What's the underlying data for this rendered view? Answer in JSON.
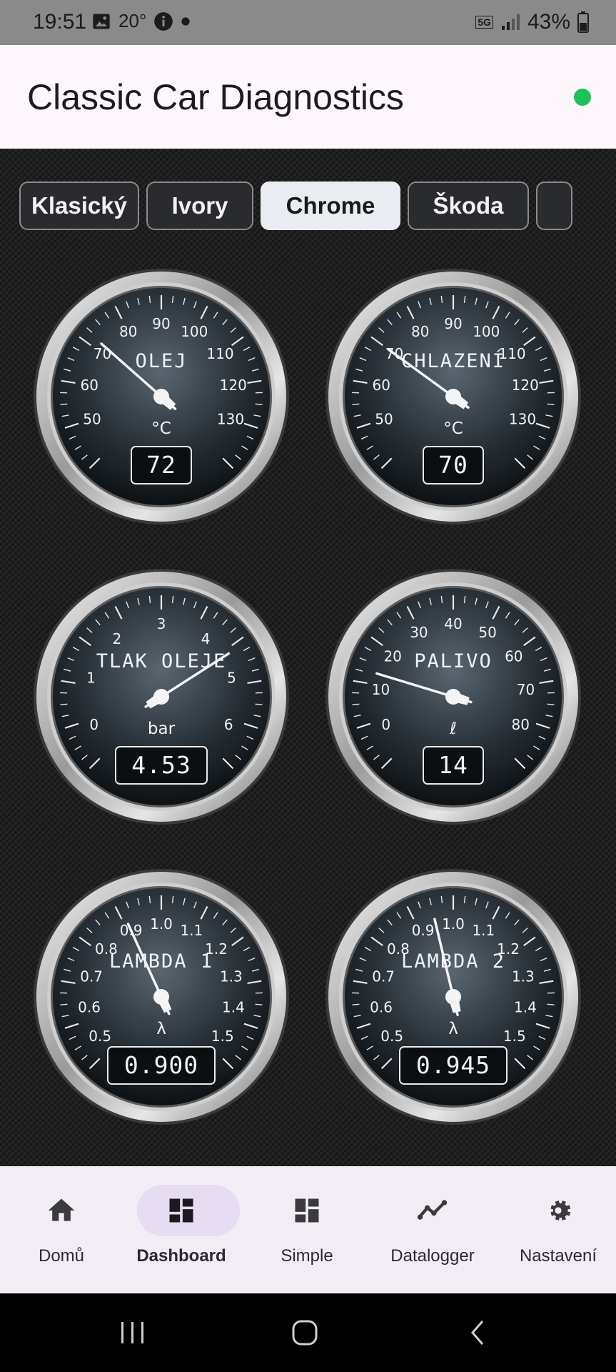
{
  "status_bar": {
    "time": "19:51",
    "temperature": "20°",
    "network": "5G",
    "battery": "43%",
    "icons": [
      "image-icon",
      "info-icon",
      "dot-icon",
      "signal-icon",
      "battery-icon"
    ]
  },
  "app": {
    "title": "Classic Car Diagnostics",
    "connection_color": "#1ec05a"
  },
  "theme_tabs": [
    {
      "label": "Klasický",
      "active": false
    },
    {
      "label": "Ivory",
      "active": false
    },
    {
      "label": "Chrome",
      "active": true
    },
    {
      "label": "Škoda",
      "active": false
    },
    {
      "label": "",
      "active": false
    }
  ],
  "gauges": [
    {
      "title": "OLEJ",
      "unit": "°C",
      "display": "72",
      "value": 72,
      "min": 40,
      "max": 140,
      "tick_labels": [
        "50",
        "60",
        "70",
        "80",
        "90",
        "100",
        "110",
        "120",
        "130"
      ],
      "tick_values": [
        50,
        60,
        70,
        80,
        90,
        100,
        110,
        120,
        130
      ]
    },
    {
      "title": "CHLAZENÍ",
      "unit": "°C",
      "display": "70",
      "value": 70,
      "min": 40,
      "max": 140,
      "tick_labels": [
        "50",
        "60",
        "70",
        "80",
        "90",
        "100",
        "110",
        "120",
        "130"
      ],
      "tick_values": [
        50,
        60,
        70,
        80,
        90,
        100,
        110,
        120,
        130
      ]
    },
    {
      "title": "TLAK OLEJE",
      "unit": "bar",
      "display": "4.53",
      "value": 4.53,
      "min": -0.6,
      "max": 6.6,
      "tick_labels": [
        "0",
        "1",
        "2",
        "3",
        "4",
        "5",
        "6"
      ],
      "tick_values": [
        0,
        1,
        2,
        3,
        4,
        5,
        6
      ]
    },
    {
      "title": "PALIVO",
      "unit": "ℓ",
      "display": "14",
      "value": 14,
      "min": -8,
      "max": 88,
      "tick_labels": [
        "0",
        "10",
        "20",
        "30",
        "40",
        "50",
        "60",
        "70",
        "80"
      ],
      "tick_values": [
        0,
        10,
        20,
        30,
        40,
        50,
        60,
        70,
        80
      ]
    },
    {
      "title": "LAMBDA 1",
      "unit": "λ",
      "display": "0.900",
      "value": 0.9,
      "min": 0.45,
      "max": 1.55,
      "tick_labels": [
        "0.5",
        "0.6",
        "0.7",
        "0.8",
        "0.9",
        "1.0",
        "1.1",
        "1.2",
        "1.3",
        "1.4",
        "1.5"
      ],
      "tick_values": [
        0.5,
        0.6,
        0.7,
        0.8,
        0.9,
        1.0,
        1.1,
        1.2,
        1.3,
        1.4,
        1.5
      ]
    },
    {
      "title": "LAMBDA 2",
      "unit": "λ",
      "display": "0.945",
      "value": 0.945,
      "min": 0.45,
      "max": 1.55,
      "tick_labels": [
        "0.5",
        "0.6",
        "0.7",
        "0.8",
        "0.9",
        "1.0",
        "1.1",
        "1.2",
        "1.3",
        "1.4",
        "1.5"
      ],
      "tick_values": [
        0.5,
        0.6,
        0.7,
        0.8,
        0.9,
        1.0,
        1.1,
        1.2,
        1.3,
        1.4,
        1.5
      ]
    }
  ],
  "bottom_nav": [
    {
      "label": "Domů",
      "icon": "home-icon",
      "active": false
    },
    {
      "label": "Dashboard",
      "icon": "dashboard-icon",
      "active": true
    },
    {
      "label": "Simple",
      "icon": "simple-icon",
      "active": false
    },
    {
      "label": "Datalogger",
      "icon": "datalogger-icon",
      "active": false
    },
    {
      "label": "Nastavení",
      "icon": "settings-icon",
      "active": false
    }
  ]
}
